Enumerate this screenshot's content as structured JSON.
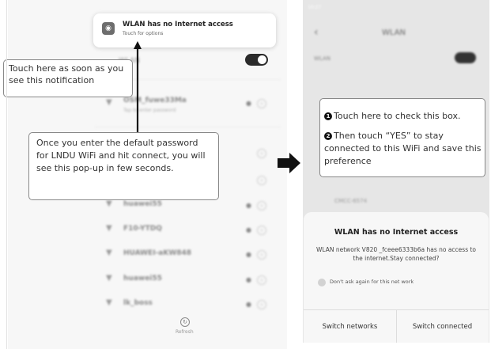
{
  "left_phone": {
    "notification": {
      "title": "WLAN has no Internet access",
      "subtitle": "Touch for options"
    },
    "wlan_label": "WLAN",
    "networks": [
      {
        "name": "OSM_fuwe33Ma",
        "sub": "Tap to enter password",
        "locked": true
      },
      {
        "name": "",
        "sub": "",
        "locked": false
      },
      {
        "name": "",
        "sub": "",
        "locked": false
      },
      {
        "name": "huawei55",
        "sub": "",
        "locked": true
      },
      {
        "name": "F10-YTDQ",
        "sub": "",
        "locked": true
      },
      {
        "name": "HUAWEI-aKW848",
        "sub": "",
        "locked": true
      },
      {
        "name": "huawei55",
        "sub": "",
        "locked": true
      },
      {
        "name": "lk_boss",
        "sub": "",
        "locked": true
      }
    ],
    "refresh_label": "Refresh"
  },
  "callouts": {
    "touch_notification": "Touch here as soon as you see this notification",
    "enter_password": "Once you enter the default password for LNDU WiFi and hit connect, you will see this pop-up in few seconds."
  },
  "right_phone": {
    "status_time": "10:27",
    "header_title": "WLAN",
    "wlan_label": "WLAN",
    "background_network": "CMCC-6574",
    "steps": [
      {
        "num": "1",
        "text": "Touch here to check this box."
      },
      {
        "num": "2",
        "text": "Then touch “YES” to stay connected to this WiFi and save this preference"
      }
    ],
    "dialog": {
      "title": "WLAN has no Internet access",
      "body": "WLAN network V820 _fceee6333b6a has no access to the internet.Stay connected?",
      "checkbox_label": "Don't ask again for this net work",
      "btn_switch_networks": "Switch networks",
      "btn_switch_connected": "Switch connected"
    }
  },
  "colors": {
    "arrow": "#111111",
    "callout_border": "#888888"
  }
}
